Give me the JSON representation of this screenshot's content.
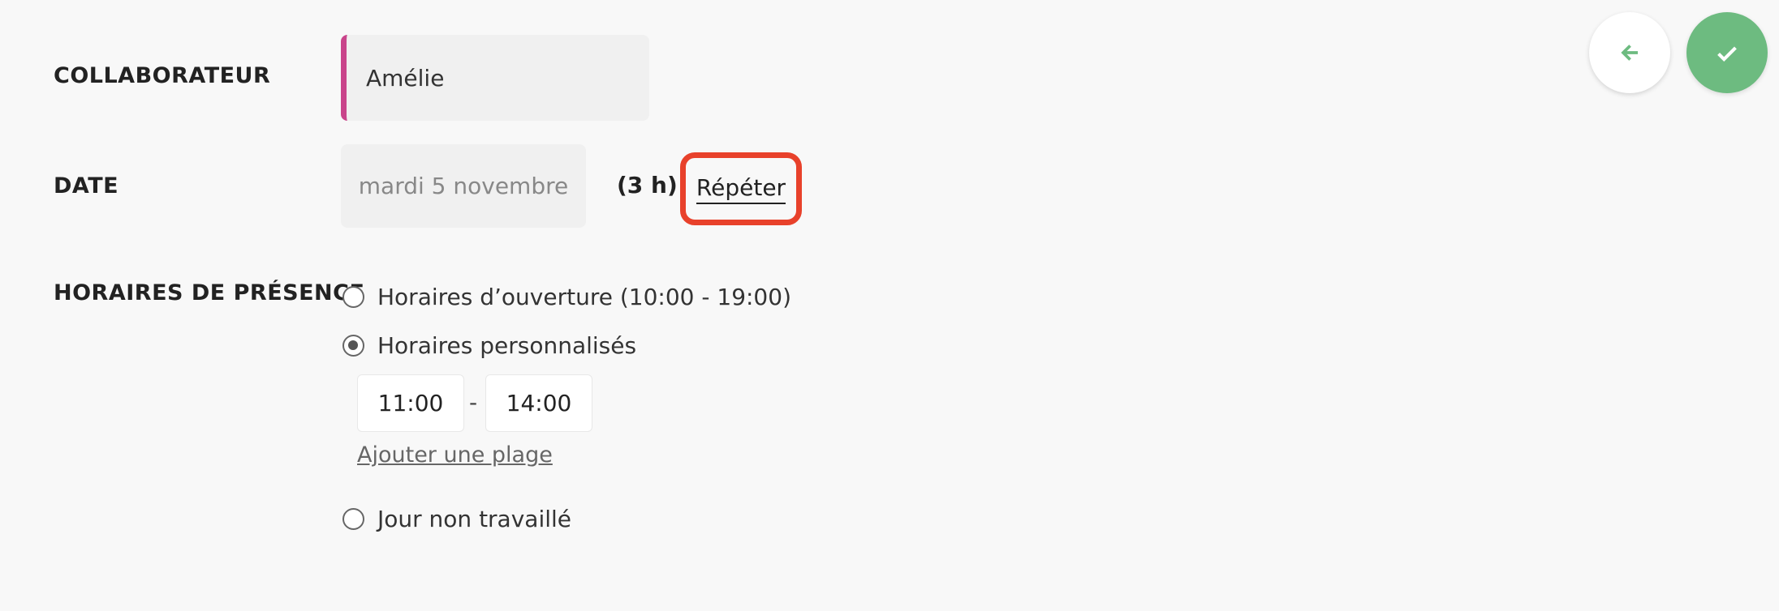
{
  "form": {
    "collaborator_label": "COLLABORATEUR",
    "collaborator_value": "Amélie",
    "date_label": "DATE",
    "date_value": "mardi 5 novembre",
    "duration": "(3 h)",
    "repeat_label": "Répéter",
    "presence_label": "HORAIRES DE PRÉSENCE",
    "options": {
      "opening_hours": "Horaires d’ouverture (10:00 - 19:00)",
      "custom_hours": "Horaires personnalisés",
      "day_off": "Jour non travaillé"
    },
    "selected_option": "custom_hours",
    "time_start": "11:00",
    "time_separator": "-",
    "time_end": "14:00",
    "add_range_label": "Ajouter une plage"
  },
  "actions": {
    "back_icon": "arrow-left-icon",
    "confirm_icon": "check-icon"
  },
  "colors": {
    "collaborator_accent": "#c9448b",
    "highlight_border": "#e8412b",
    "confirm_button": "#6dbb80",
    "back_arrow": "#6dbb80"
  }
}
